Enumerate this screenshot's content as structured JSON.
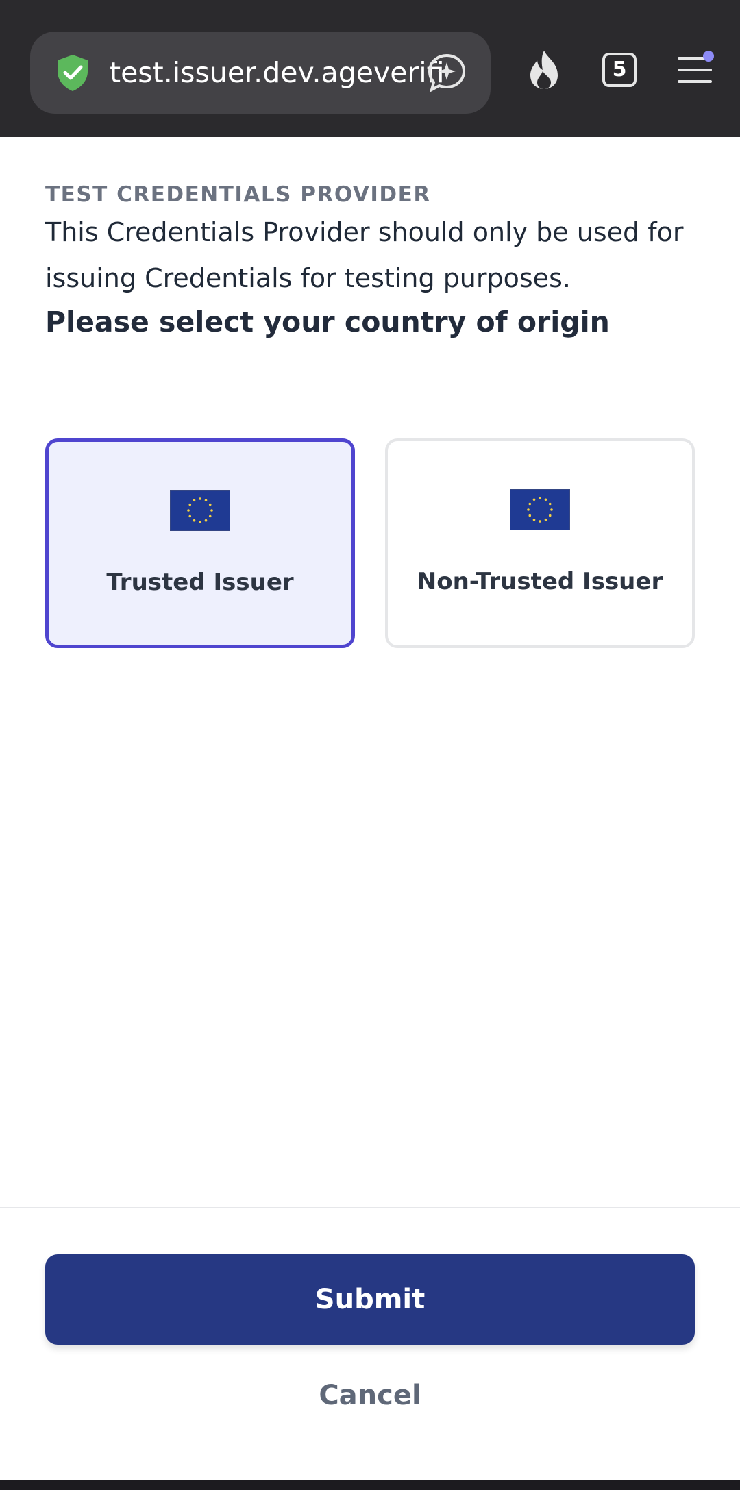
{
  "browser": {
    "url": "test.issuer.dev.ageverification",
    "tab_count": "5",
    "icons": {
      "security": "shield-check-icon",
      "assistant": "sparkle-chat-icon",
      "private": "fire-icon",
      "tabs": "tabs-counter-icon",
      "menu": "hamburger-menu-icon"
    },
    "menu_badge_color": "#8d8bf6"
  },
  "content": {
    "eyebrow": "TEST CREDENTIALS PROVIDER",
    "description": "This Credentials Provider should only be used for issuing Credentials for testing purposes.",
    "prompt": "Please select your country of origin"
  },
  "options": [
    {
      "label": "Trusted Issuer",
      "icon": "eu-flag-icon",
      "selected": true
    },
    {
      "label": "Non-Trusted Issuer",
      "icon": "eu-flag-icon",
      "selected": false
    }
  ],
  "actions": {
    "submit_label": "Submit",
    "cancel_label": "Cancel"
  },
  "colors": {
    "primary": "#263883",
    "selected_border": "#4f45cf",
    "selected_bg": "#eef0fd",
    "toolbar": "#2b2a2d"
  }
}
